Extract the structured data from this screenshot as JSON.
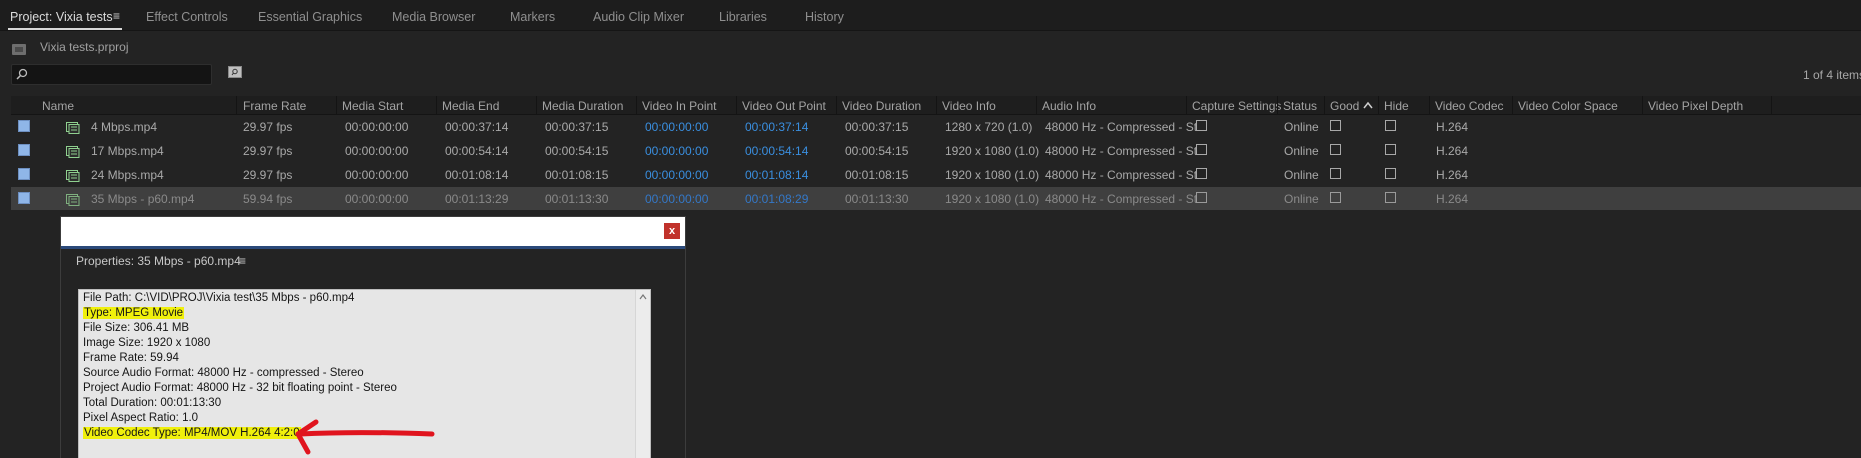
{
  "tabs": [
    {
      "label": "Project: Vixia tests",
      "active": true
    },
    {
      "label": "Effect Controls"
    },
    {
      "label": "Essential Graphics"
    },
    {
      "label": "Media Browser"
    },
    {
      "label": "Markers"
    },
    {
      "label": "Audio Clip Mixer"
    },
    {
      "label": "Libraries"
    },
    {
      "label": "History"
    }
  ],
  "tab_menu_glyph": "≡",
  "project": {
    "file_name": "Vixia tests.prproj"
  },
  "search": {
    "value": "",
    "icon": "search-icon"
  },
  "items_count": "1 of 4 items",
  "columns": [
    "Name",
    "Frame Rate",
    "Media Start",
    "Media End",
    "Media Duration",
    "Video In Point",
    "Video Out Point",
    "Video Duration",
    "Video Info",
    "Audio Info",
    "Capture Settings",
    "Status",
    "Good",
    "Hide",
    "Video Codec",
    "Video Color Space",
    "Video Pixel Depth"
  ],
  "sort_indicator": "^",
  "rows": [
    {
      "name": "4 Mbps.mp4",
      "frame_rate": "29.97 fps",
      "media_start": "00:00:00:00",
      "media_end": "00:00:37:14",
      "media_duration": "00:00:37:15",
      "video_in": "00:00:00:00",
      "video_out": "00:00:37:14",
      "video_duration": "00:00:37:15",
      "video_info": "1280 x 720 (1.0)",
      "audio_info": "48000 Hz - Compressed - St",
      "status": "Online",
      "codec": "H.264",
      "selected": false
    },
    {
      "name": "17 Mbps.mp4",
      "frame_rate": "29.97 fps",
      "media_start": "00:00:00:00",
      "media_end": "00:00:54:14",
      "media_duration": "00:00:54:15",
      "video_in": "00:00:00:00",
      "video_out": "00:00:54:14",
      "video_duration": "00:00:54:15",
      "video_info": "1920 x 1080 (1.0)",
      "audio_info": "48000 Hz - Compressed - St",
      "status": "Online",
      "codec": "H.264",
      "selected": false
    },
    {
      "name": "24 Mbps.mp4",
      "frame_rate": "29.97 fps",
      "media_start": "00:00:00:00",
      "media_end": "00:01:08:14",
      "media_duration": "00:01:08:15",
      "video_in": "00:00:00:00",
      "video_out": "00:01:08:14",
      "video_duration": "00:01:08:15",
      "video_info": "1920 x 1080 (1.0)",
      "audio_info": "48000 Hz - Compressed - St",
      "status": "Online",
      "codec": "H.264",
      "selected": false
    },
    {
      "name": "35 Mbps - p60.mp4",
      "frame_rate": "59.94 fps",
      "media_start": "00:00:00:00",
      "media_end": "00:01:13:29",
      "media_duration": "00:01:13:30",
      "video_in": "00:00:00:00",
      "video_out": "00:01:08:29",
      "video_duration": "00:01:13:30",
      "video_info": "1920 x 1080 (1.0)",
      "audio_info": "48000 Hz - Compressed - St",
      "status": "Online",
      "codec": "H.264",
      "selected": true
    }
  ],
  "dialog": {
    "close_label": "x",
    "title": "Properties: 35 Mbps - p60.mp4",
    "menu_glyph": "≡",
    "lines": [
      {
        "text": "File Path: C:\\VID\\PROJ\\Vixia test\\35 Mbps - p60.mp4",
        "highlight": false
      },
      {
        "text": "Type: MPEG Movie",
        "highlight": true
      },
      {
        "text": "File Size: 306.41 MB",
        "highlight": false
      },
      {
        "text": "Image Size: 1920 x 1080",
        "highlight": false
      },
      {
        "text": "Frame Rate: 59.94",
        "highlight": false
      },
      {
        "text": "Source Audio Format: 48000 Hz - compressed - Stereo",
        "highlight": false
      },
      {
        "text": "Project Audio Format: 48000 Hz - 32 bit floating point - Stereo",
        "highlight": false
      },
      {
        "text": "Total Duration: 00:01:13:30",
        "highlight": false
      },
      {
        "text": "Pixel Aspect Ratio: 1.0",
        "highlight": false
      },
      {
        "text": "Video Codec Type: MP4/MOV H.264 4:2:0",
        "highlight": true
      }
    ]
  },
  "colors": {
    "timecode_blue": "#3a8fe0",
    "highlight_yellow": "#f0f00c",
    "annotation_red": "#e0141e",
    "close_red": "#c1322b"
  }
}
